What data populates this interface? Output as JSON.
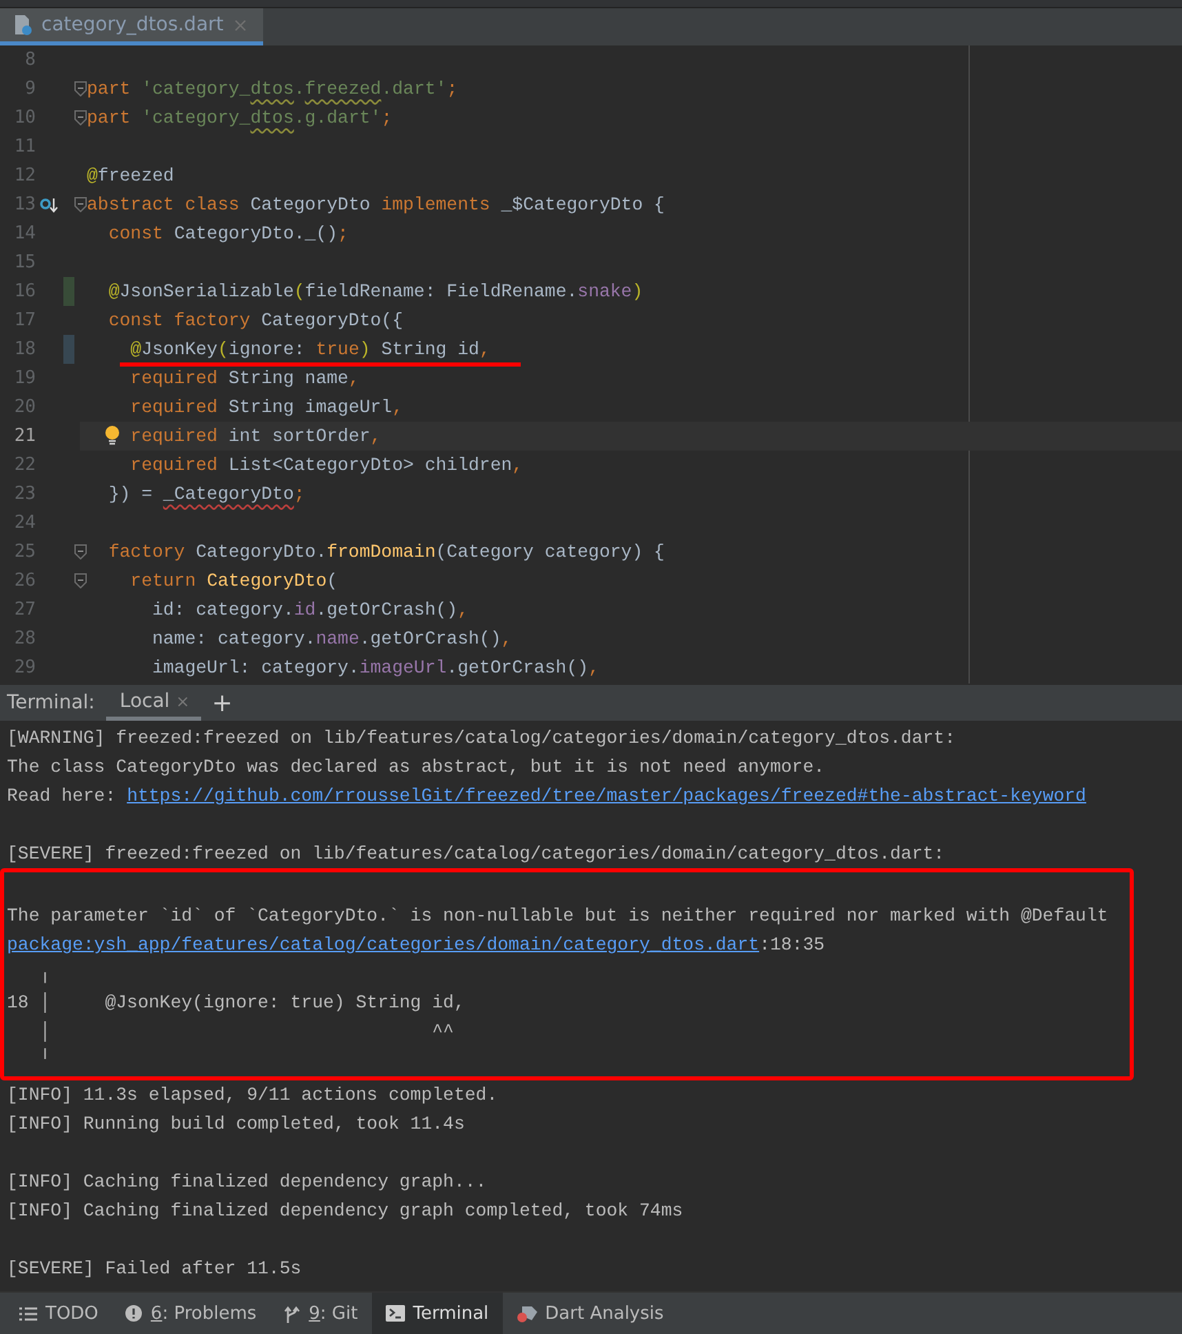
{
  "editor": {
    "tabs": [
      {
        "label": "category_dtos.dart",
        "selected": true
      }
    ],
    "lines": [
      {
        "number": "8",
        "current": false,
        "fold": false,
        "underlined": false
      },
      {
        "number": "9",
        "current": false,
        "fold": true,
        "underlined": false,
        "tokens": [
          {
            "text": "part ",
            "kind": "kw"
          },
          {
            "text": "'category_",
            "kind": "str"
          },
          {
            "text": "dtos",
            "kind": "str",
            "squiggle": {
              "kind": "warning"
            }
          },
          {
            "text": ".",
            "kind": "str"
          },
          {
            "text": "freezed",
            "kind": "str",
            "squiggle": {
              "kind": "warning"
            }
          },
          {
            "text": ".dart'",
            "kind": "str"
          },
          {
            "text": ";",
            "kind": "punct"
          }
        ]
      },
      {
        "number": "10",
        "current": false,
        "fold": true,
        "underlined": false,
        "tokens": [
          {
            "text": "part ",
            "kind": "kw"
          },
          {
            "text": "'category_",
            "kind": "str"
          },
          {
            "text": "dtos",
            "kind": "str",
            "squiggle": {
              "kind": "warning"
            }
          },
          {
            "text": ".g.dart'",
            "kind": "str"
          },
          {
            "text": ";",
            "kind": "punct"
          }
        ]
      },
      {
        "number": "11",
        "current": false,
        "fold": false,
        "underlined": false
      },
      {
        "number": "12",
        "current": false,
        "fold": false,
        "underlined": false,
        "tokens": [
          {
            "text": "@",
            "kind": "ann"
          },
          {
            "text": "freezed",
            "kind": "plain"
          }
        ]
      },
      {
        "number": "13",
        "current": false,
        "fold": true,
        "underlined": false,
        "gutter_icon": {
          "kind": "override"
        },
        "tokens": [
          {
            "text": "abstract class ",
            "kind": "kw"
          },
          {
            "text": "CategoryDto ",
            "kind": "plain"
          },
          {
            "text": "implements ",
            "kind": "kw"
          },
          {
            "text": "_$CategoryDto {",
            "kind": "plain"
          }
        ]
      },
      {
        "number": "14",
        "current": false,
        "fold": false,
        "underlined": false,
        "tokens": [
          {
            "text": "  const ",
            "kind": "kw"
          },
          {
            "text": "CategoryDto._()",
            "kind": "plain"
          },
          {
            "text": ";",
            "kind": "punct"
          }
        ]
      },
      {
        "number": "15",
        "current": false,
        "fold": false,
        "underlined": false
      },
      {
        "number": "16",
        "current": false,
        "fold": false,
        "underlined": false,
        "change": {
          "kind": "added"
        },
        "tokens": [
          {
            "text": "  @",
            "kind": "ann"
          },
          {
            "text": "JsonSerializable",
            "kind": "plain"
          },
          {
            "text": "(",
            "kind": "ann"
          },
          {
            "text": "fieldRename: FieldRename.",
            "kind": "plain"
          },
          {
            "text": "snake",
            "kind": "field"
          },
          {
            "text": ")",
            "kind": "ann"
          }
        ]
      },
      {
        "number": "17",
        "current": false,
        "fold": false,
        "underlined": false,
        "tokens": [
          {
            "text": "  const factory ",
            "kind": "kw"
          },
          {
            "text": "CategoryDto({",
            "kind": "plain"
          }
        ]
      },
      {
        "number": "18",
        "current": false,
        "fold": false,
        "underlined": true,
        "change": {
          "kind": "modified"
        },
        "tokens": [
          {
            "text": "    @",
            "kind": "ann"
          },
          {
            "text": "JsonKey",
            "kind": "plain"
          },
          {
            "text": "(",
            "kind": "ann"
          },
          {
            "text": "ignore: ",
            "kind": "plain"
          },
          {
            "text": "true",
            "kind": "kw"
          },
          {
            "text": ")",
            "kind": "ann"
          },
          {
            "text": " String id",
            "kind": "plain"
          },
          {
            "text": ",",
            "kind": "punct"
          }
        ]
      },
      {
        "number": "19",
        "current": false,
        "fold": false,
        "underlined": false,
        "tokens": [
          {
            "text": "    required ",
            "kind": "kw"
          },
          {
            "text": "String name",
            "kind": "plain"
          },
          {
            "text": ",",
            "kind": "punct"
          }
        ]
      },
      {
        "number": "20",
        "current": false,
        "fold": false,
        "underlined": false,
        "tokens": [
          {
            "text": "    required ",
            "kind": "kw"
          },
          {
            "text": "String imageUrl",
            "kind": "plain"
          },
          {
            "text": ",",
            "kind": "punct"
          }
        ]
      },
      {
        "number": "21",
        "current": true,
        "fold": false,
        "underlined": false,
        "gutter_icon": {
          "kind": "intention"
        },
        "tokens": [
          {
            "text": "    required ",
            "kind": "kw"
          },
          {
            "text": "int sortOrder",
            "kind": "plain"
          },
          {
            "text": ",",
            "kind": "punct"
          }
        ]
      },
      {
        "number": "22",
        "current": false,
        "fold": false,
        "underlined": false,
        "tokens": [
          {
            "text": "    required ",
            "kind": "kw"
          },
          {
            "text": "List<CategoryDto> children",
            "kind": "plain"
          },
          {
            "text": ",",
            "kind": "punct"
          }
        ]
      },
      {
        "number": "23",
        "current": false,
        "fold": false,
        "underlined": false,
        "tokens": [
          {
            "text": "  }) = ",
            "kind": "plain"
          },
          {
            "text": "_CategoryDto",
            "kind": "plain",
            "squiggle": {
              "kind": "error"
            }
          },
          {
            "text": ";",
            "kind": "punct"
          }
        ]
      },
      {
        "number": "24",
        "current": false,
        "fold": false,
        "underlined": false
      },
      {
        "number": "25",
        "current": false,
        "fold": true,
        "underlined": false,
        "tokens": [
          {
            "text": "  factory ",
            "kind": "kw"
          },
          {
            "text": "CategoryDto.",
            "kind": "plain"
          },
          {
            "text": "fromDomain",
            "kind": "method"
          },
          {
            "text": "(Category category) {",
            "kind": "plain"
          }
        ]
      },
      {
        "number": "26",
        "current": false,
        "fold": true,
        "underlined": false,
        "tokens": [
          {
            "text": "    return ",
            "kind": "kw"
          },
          {
            "text": "CategoryDto",
            "kind": "method"
          },
          {
            "text": "(",
            "kind": "plain"
          }
        ]
      },
      {
        "number": "27",
        "current": false,
        "fold": false,
        "underlined": false,
        "tokens": [
          {
            "text": "      id: category.",
            "kind": "plain"
          },
          {
            "text": "id",
            "kind": "field"
          },
          {
            "text": ".getOrCrash()",
            "kind": "plain"
          },
          {
            "text": ",",
            "kind": "punct"
          }
        ]
      },
      {
        "number": "28",
        "current": false,
        "fold": false,
        "underlined": false,
        "tokens": [
          {
            "text": "      name: category.",
            "kind": "plain"
          },
          {
            "text": "name",
            "kind": "field"
          },
          {
            "text": ".getOrCrash()",
            "kind": "plain"
          },
          {
            "text": ",",
            "kind": "punct"
          }
        ]
      },
      {
        "number": "29",
        "current": false,
        "fold": false,
        "underlined": false,
        "tokens": [
          {
            "text": "      imageUrl: category.",
            "kind": "plain"
          },
          {
            "text": "imageUrl",
            "kind": "field"
          },
          {
            "text": ".getOrCrash()",
            "kind": "plain"
          },
          {
            "text": ",",
            "kind": "punct"
          }
        ]
      }
    ]
  },
  "terminal": {
    "label": "Terminal:",
    "tabs": [
      {
        "label": "Local",
        "selected": true,
        "close": "×"
      }
    ],
    "add": "+",
    "blocks": [
      {
        "highlighted": false,
        "paragraphs": [
          {
            "lines": [
              {
                "segments": [
                  {
                    "text": "[WARNING] freezed:freezed on lib/features/catalog/categories/domain/category_dtos.dart:",
                    "kind": "text"
                  }
                ]
              },
              {
                "segments": [
                  {
                    "text": "The class CategoryDto was declared as abstract, but it is not need anymore.",
                    "kind": "text"
                  }
                ]
              },
              {
                "segments": [
                  {
                    "text": "Read here: ",
                    "kind": "text"
                  },
                  {
                    "text": "https://github.com/rrousselGit/freezed/tree/master/packages/freezed#the-abstract-keyword",
                    "kind": "link"
                  }
                ]
              }
            ]
          },
          {
            "lines": [
              {
                "segments": [
                  {
                    "text": "[SEVERE] freezed:freezed on lib/features/catalog/categories/domain/category_dtos.dart:",
                    "kind": "text"
                  }
                ]
              }
            ]
          }
        ]
      },
      {
        "highlighted": true,
        "paragraphs": [
          {
            "lines": [
              {
                "segments": [
                  {
                    "text": "The parameter `id` of `CategoryDto.` is non-nullable but is neither required nor marked with @Default",
                    "kind": "text"
                  }
                ]
              },
              {
                "segments": [
                  {
                    "text": "package:ysh_app/features/catalog/categories/domain/category_dtos.dart",
                    "kind": "link"
                  },
                  {
                    "text": ":18:35",
                    "kind": "text"
                  }
                ]
              },
              {
                "segments": [
                  {
                    "text": "   ╷",
                    "kind": "text"
                  }
                ]
              },
              {
                "segments": [
                  {
                    "text": "18 │     @JsonKey(ignore: true) String id,",
                    "kind": "text"
                  }
                ]
              },
              {
                "segments": [
                  {
                    "text": "   │                                   ^^",
                    "kind": "text"
                  }
                ]
              },
              {
                "segments": [
                  {
                    "text": "   ╵",
                    "kind": "text"
                  }
                ]
              }
            ]
          }
        ]
      },
      {
        "highlighted": false,
        "paragraphs": [
          {
            "lines": [
              {
                "segments": [
                  {
                    "text": "[INFO] 11.3s elapsed, 9/11 actions completed.",
                    "kind": "text"
                  }
                ]
              },
              {
                "segments": [
                  {
                    "text": "[INFO] Running build completed, took 11.4s",
                    "kind": "text"
                  }
                ]
              }
            ]
          },
          {
            "lines": [
              {
                "segments": [
                  {
                    "text": "[INFO] Caching finalized dependency graph...",
                    "kind": "text"
                  }
                ]
              },
              {
                "segments": [
                  {
                    "text": "[INFO] Caching finalized dependency graph completed, took 74ms",
                    "kind": "text"
                  }
                ]
              }
            ]
          },
          {
            "lines": [
              {
                "segments": [
                  {
                    "text": "[SEVERE] Failed after 11.5s",
                    "kind": "text"
                  }
                ]
              }
            ]
          }
        ]
      }
    ]
  },
  "tool_windows": [
    {
      "kind": "todo",
      "label": "TODO",
      "selected": false
    },
    {
      "kind": "problems",
      "mnemonic": "6",
      "label": ": Problems",
      "selected": false
    },
    {
      "kind": "git",
      "mnemonic": "9",
      "label": ": Git",
      "selected": false
    },
    {
      "kind": "terminal",
      "label": "Terminal",
      "selected": true
    },
    {
      "kind": "dart",
      "label": "Dart Analysis",
      "selected": false
    }
  ]
}
